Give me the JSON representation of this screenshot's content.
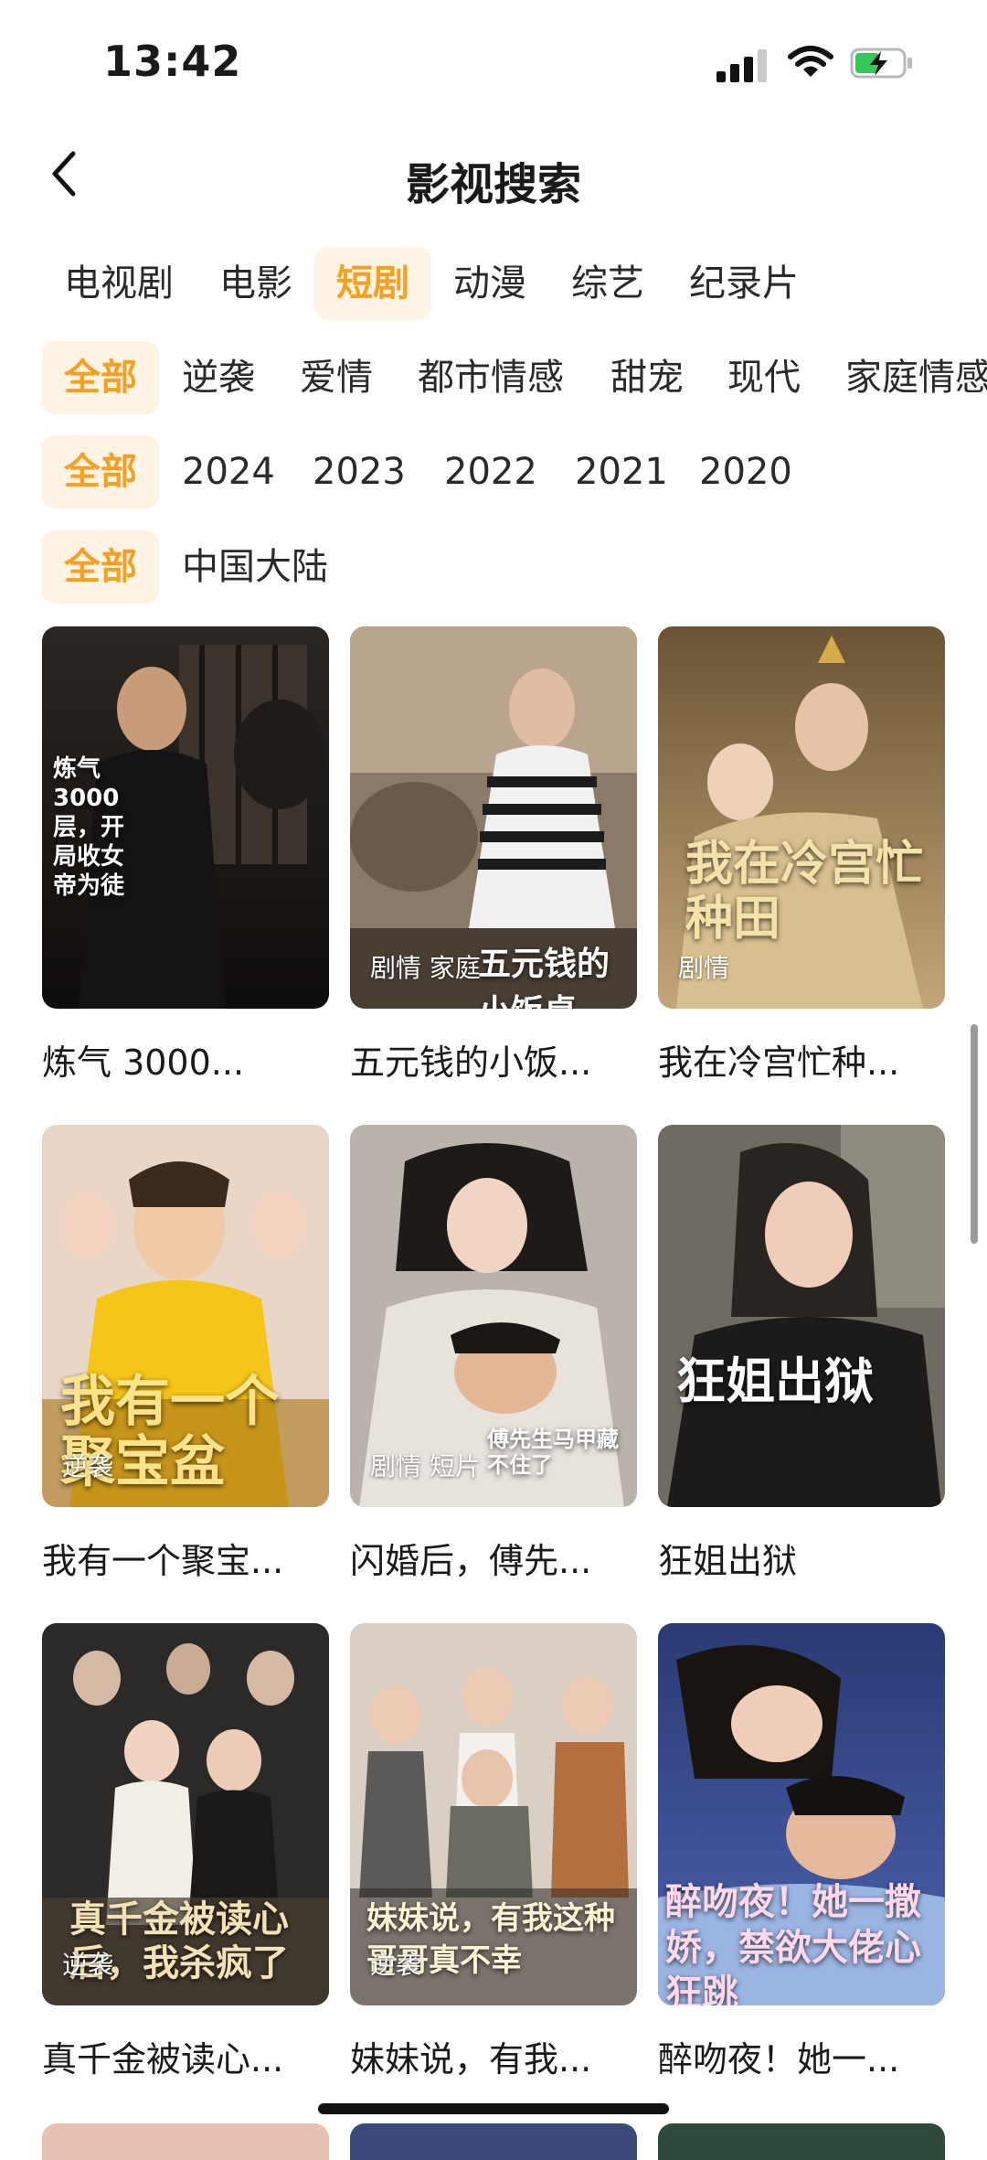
{
  "status_bar": {
    "time": "13:42"
  },
  "header": {
    "title": "影视搜索"
  },
  "category_tabs": [
    "电视剧",
    "电影",
    "短剧",
    "动漫",
    "综艺",
    "纪录片"
  ],
  "genre_filters": [
    "全部",
    "逆袭",
    "爱情",
    "都市情感",
    "甜宠",
    "现代",
    "家庭情感"
  ],
  "year_filters": [
    "全部",
    "2024",
    "2023",
    "2022",
    "2021",
    "2020"
  ],
  "region_filters": [
    "全部",
    "中国大陆"
  ],
  "items": [
    {
      "caption": "炼气 3000...",
      "tag": "",
      "poster_text": "炼气3000层，开局收女帝为徒"
    },
    {
      "caption": "五元钱的小饭...",
      "tag": "剧情 家庭",
      "poster_text": "五元钱的小饭桌"
    },
    {
      "caption": "我在冷宫忙种...",
      "tag": "剧情",
      "poster_text": "我在冷宫忙种田"
    },
    {
      "caption": "我有一个聚宝...",
      "tag": "逆袭",
      "poster_text": "我有一个聚宝盆"
    },
    {
      "caption": "闪婚后，傅先...",
      "tag": "剧情 短片",
      "poster_text": "傅先生马甲藏不住了"
    },
    {
      "caption": "狂姐出狱",
      "tag": "",
      "poster_text": "狂姐出狱"
    },
    {
      "caption": "真千金被读心...",
      "tag": "逆袭",
      "poster_text": "真千金被读心后，我杀疯了"
    },
    {
      "caption": "妹妹说，有我...",
      "tag": "逆袭",
      "poster_text": "妹妹说，有我这种哥哥真不幸"
    },
    {
      "caption": "醉吻夜！她一...",
      "tag": "",
      "poster_text": "醉吻夜！她一撒娇，禁欲大佬心狂跳"
    }
  ],
  "colors": {
    "accent": "#f5a021",
    "accent_bg": "#fff3e4"
  }
}
